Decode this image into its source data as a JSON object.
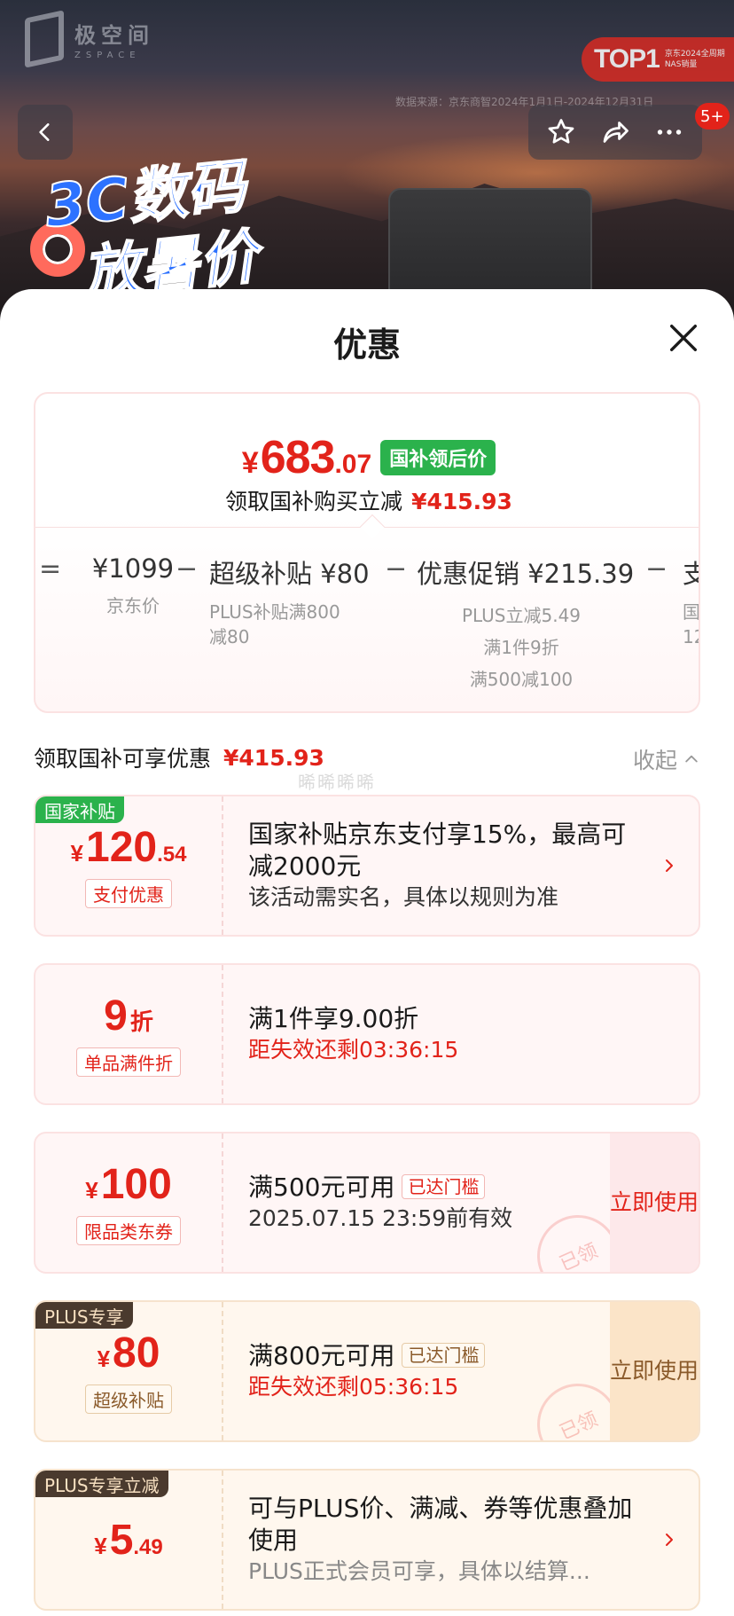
{
  "banner": {
    "brand_cn": "极空间",
    "brand_en": "ZSPACE",
    "top_badge": "TOP1",
    "top_badge_sub": "京东2024全周期 NAS销量",
    "data_source": "数据来源：京东商智2024年1月1日-2024年12月31日",
    "promo_line1": "3C数码",
    "promo_line2": "放暑价",
    "cart_badge": "5+",
    "icons": [
      "back-arrow-icon",
      "star-icon",
      "share-icon",
      "more-icon"
    ]
  },
  "sheet": {
    "title": "优惠",
    "close_icon": "close-icon"
  },
  "price_card": {
    "currency": "¥",
    "final_int": "683",
    "final_dec": ".07",
    "final_tag": "国补领后价",
    "subsidy_text": "领取国补购买立减",
    "subsidy_amount": "¥415.93",
    "breakdown": [
      {
        "op": "=",
        "value": "¥1099",
        "sub": [
          "京东价"
        ]
      },
      {
        "op": "−",
        "value": "超级补贴 ¥80",
        "sub": [
          "PLUS补贴满800",
          "减80"
        ]
      },
      {
        "op": "−",
        "value": "优惠促销 ¥215.39",
        "sub": [
          "PLUS立减5.49",
          "满1件9折",
          "满500减100"
        ]
      },
      {
        "op": "−",
        "value": "支",
        "sub": [
          "国",
          "12"
        ]
      }
    ]
  },
  "section": {
    "label": "领取国补可享优惠",
    "amount": "¥415.93",
    "collapse_label": "收起",
    "watermark": "晞晞晞晞"
  },
  "offers": [
    {
      "tag": "国家补贴",
      "currency": "¥",
      "int": "120",
      "dec": ".54",
      "label": "支付优惠",
      "title": "国家补贴京东支付享15%，最高可减2000元",
      "desc": "该活动需实名，具体以规则为准"
    },
    {
      "int": "9",
      "unit": "折",
      "label": "单品满件折",
      "title": "满1件享9.00折",
      "desc": "距失效还剩03:36:15"
    },
    {
      "currency": "¥",
      "int": "100",
      "label": "限品类东券",
      "title": "满500元可用",
      "met": "已达门槛",
      "desc": "2025.07.15 23:59前有效",
      "button": "立即使用",
      "stamp": "已领"
    },
    {
      "tag": "PLUS专享",
      "currency": "¥",
      "int": "80",
      "label": "超级补贴",
      "title": "满800元可用",
      "met": "已达门槛",
      "desc": "距失效还剩05:36:15",
      "button": "立即使用",
      "stamp": "已领"
    },
    {
      "tag": "PLUS专享立减",
      "currency": "¥",
      "int": "5",
      "dec": ".49",
      "title": "可与PLUS价、满减、券等优惠叠加使用",
      "desc": "PLUS正式会员可享，具体以结算..."
    }
  ],
  "colors": {
    "accent_red": "#e2231a",
    "green_tag": "#2bb24c",
    "plus_dark": "#4a3a2e"
  }
}
